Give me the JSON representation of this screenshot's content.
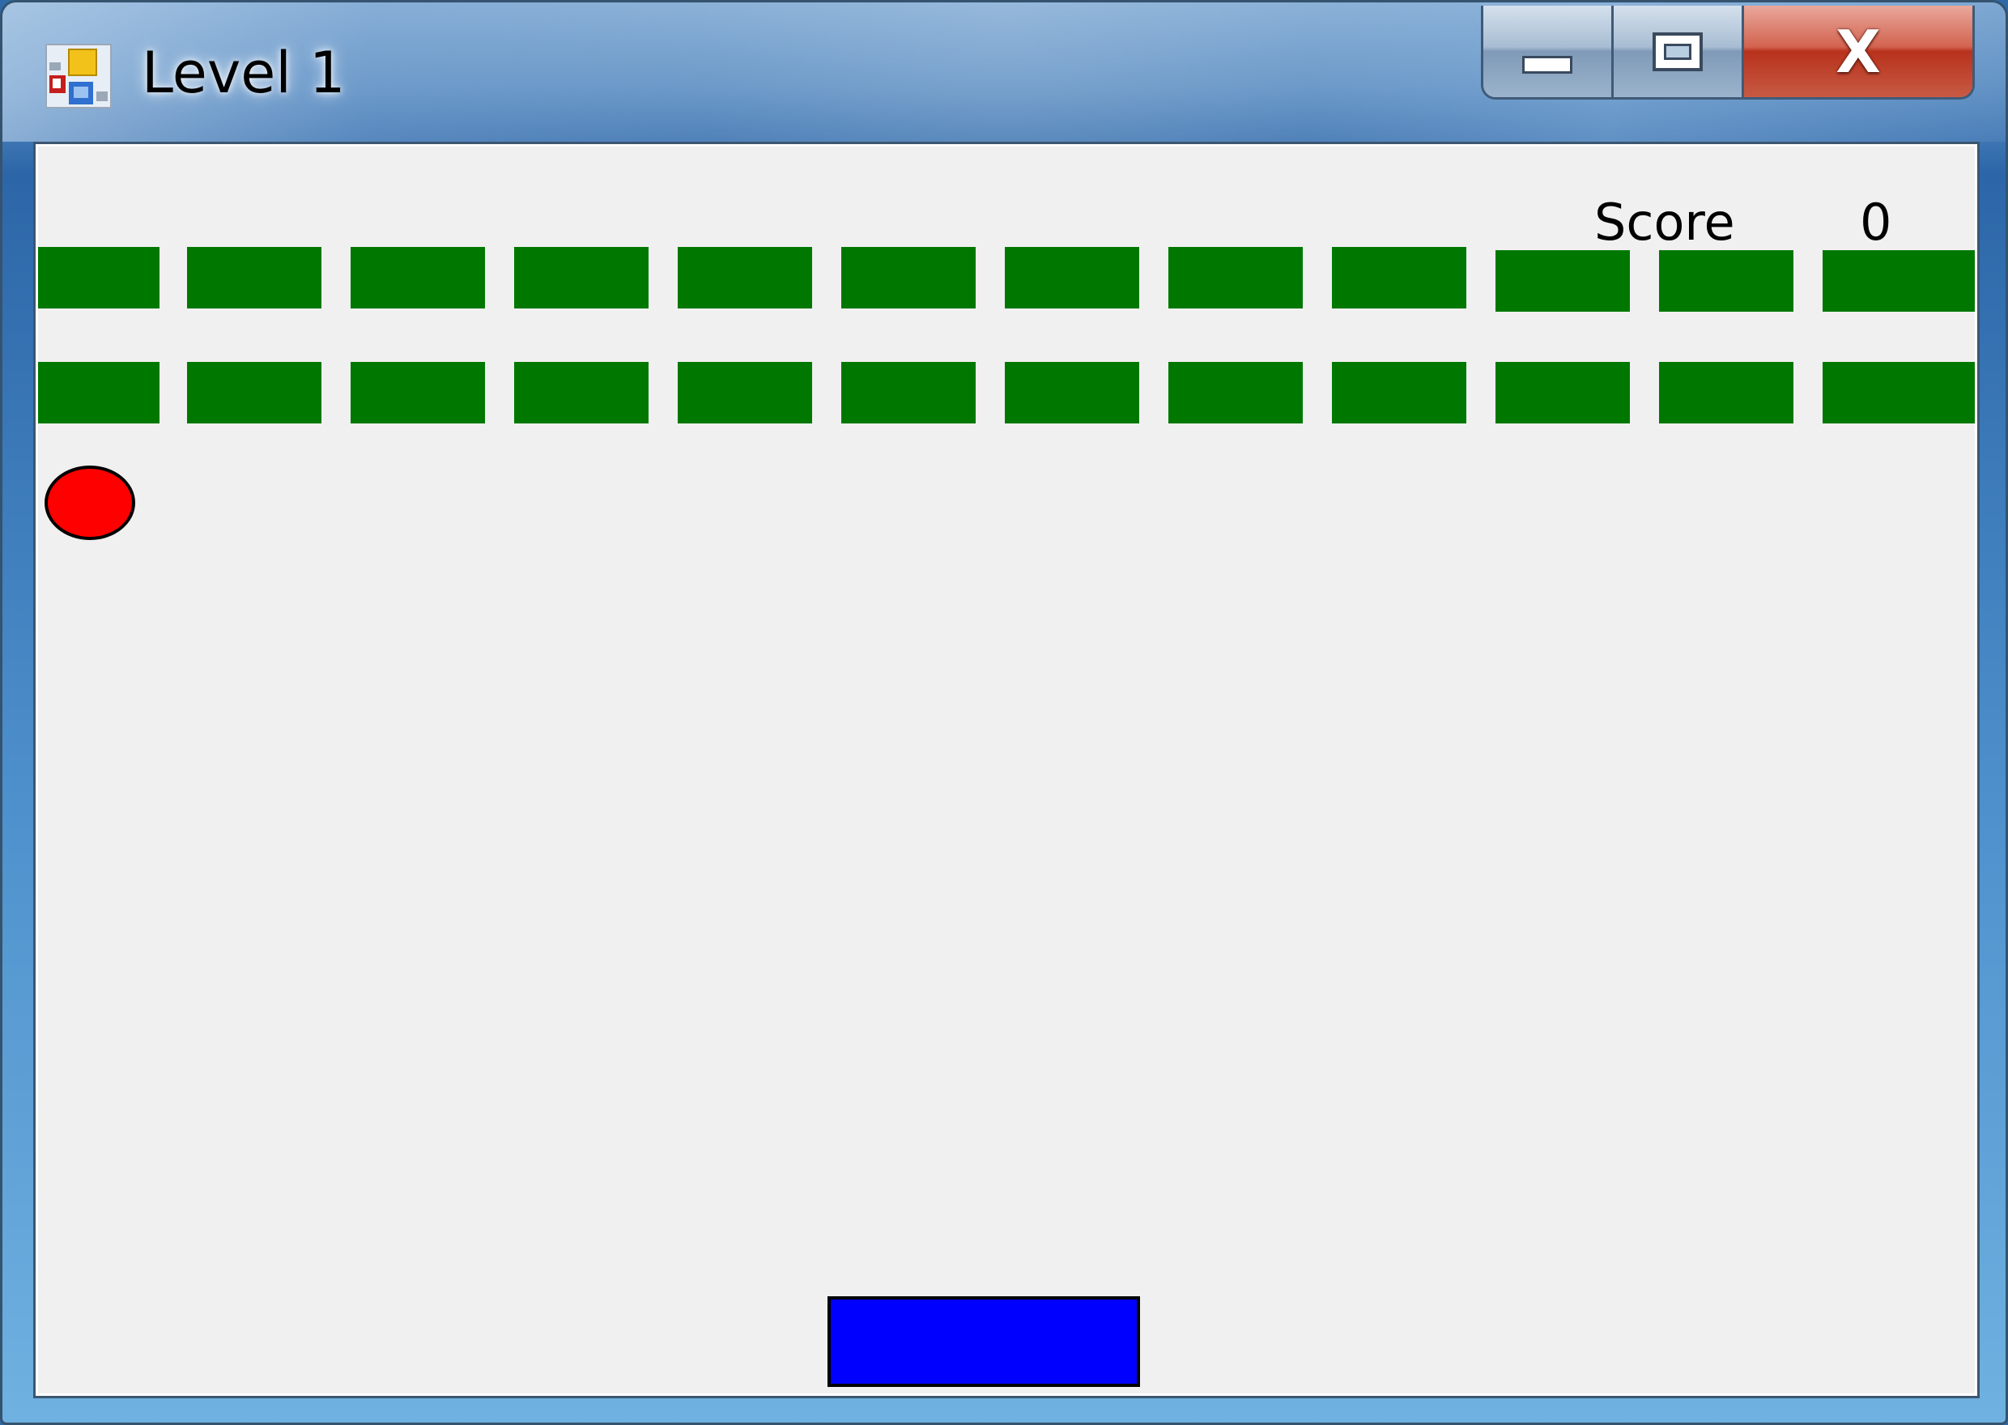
{
  "window": {
    "title": "Level 1",
    "minimize_icon": "minimize-icon",
    "maximize_icon": "maximize-icon",
    "close_icon": "close-icon",
    "close_glyph": "X"
  },
  "hud": {
    "score_label": "Score",
    "score_value": "0"
  },
  "game": {
    "brick_rows": 2,
    "bricks_per_row": 12,
    "brick_color": "#007800",
    "ball_color": "#ff0000",
    "paddle_color": "#0000ff",
    "background_color": "#f0f0f0"
  }
}
